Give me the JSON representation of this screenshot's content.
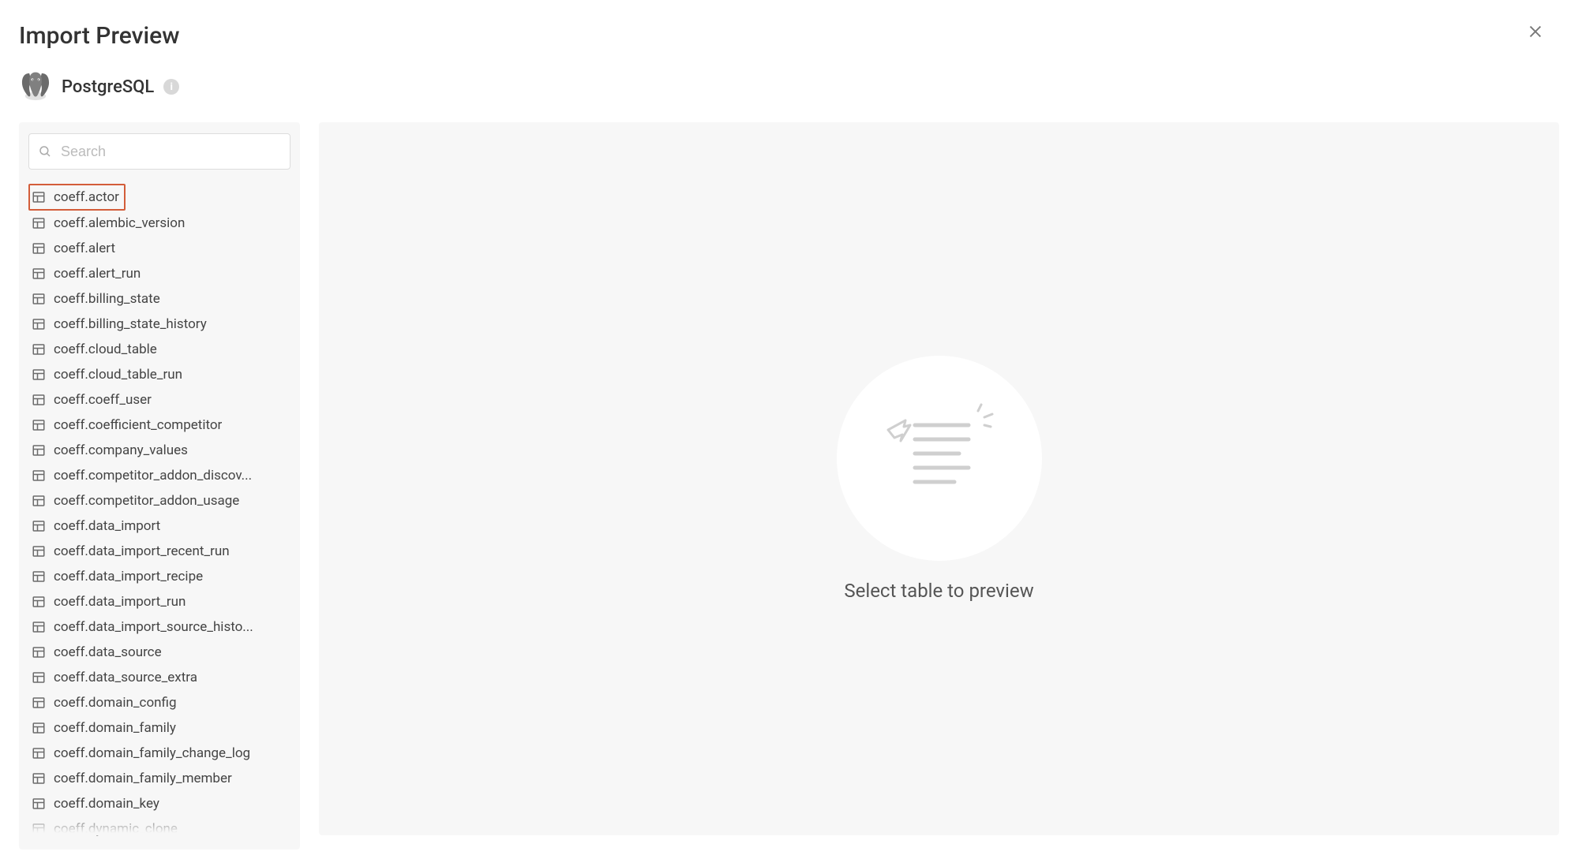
{
  "header": {
    "title": "Import Preview"
  },
  "source": {
    "name": "PostgreSQL",
    "info_glyph": "i"
  },
  "search": {
    "placeholder": "Search",
    "value": ""
  },
  "sidebar": {
    "selected_index": 0,
    "tables": [
      "coeff.actor",
      "coeff.alembic_version",
      "coeff.alert",
      "coeff.alert_run",
      "coeff.billing_state",
      "coeff.billing_state_history",
      "coeff.cloud_table",
      "coeff.cloud_table_run",
      "coeff.coeff_user",
      "coeff.coefficient_competitor",
      "coeff.company_values",
      "coeff.competitor_addon_discov...",
      "coeff.competitor_addon_usage",
      "coeff.data_import",
      "coeff.data_import_recent_run",
      "coeff.data_import_recipe",
      "coeff.data_import_run",
      "coeff.data_import_source_histo...",
      "coeff.data_source",
      "coeff.data_source_extra",
      "coeff.domain_config",
      "coeff.domain_family",
      "coeff.domain_family_change_log",
      "coeff.domain_family_member",
      "coeff.domain_key",
      "coeff.dynamic_clone"
    ]
  },
  "preview": {
    "empty_text": "Select table to preview"
  }
}
